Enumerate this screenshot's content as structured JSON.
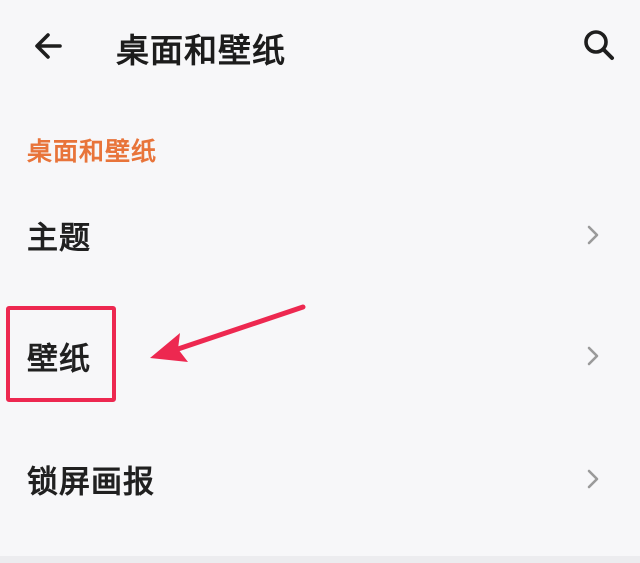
{
  "header": {
    "back_icon": "arrow-left-icon",
    "title": "桌面和壁纸",
    "search_icon": "search-icon"
  },
  "section": {
    "title": "桌面和壁纸",
    "accent_color": "#e8743a"
  },
  "items": [
    {
      "label": "主题",
      "icon": "chevron-right-icon"
    },
    {
      "label": "壁纸",
      "icon": "chevron-right-icon"
    },
    {
      "label": "锁屏画报",
      "icon": "chevron-right-icon"
    }
  ],
  "annotation": {
    "color": "#ed2850",
    "target": "壁纸"
  }
}
